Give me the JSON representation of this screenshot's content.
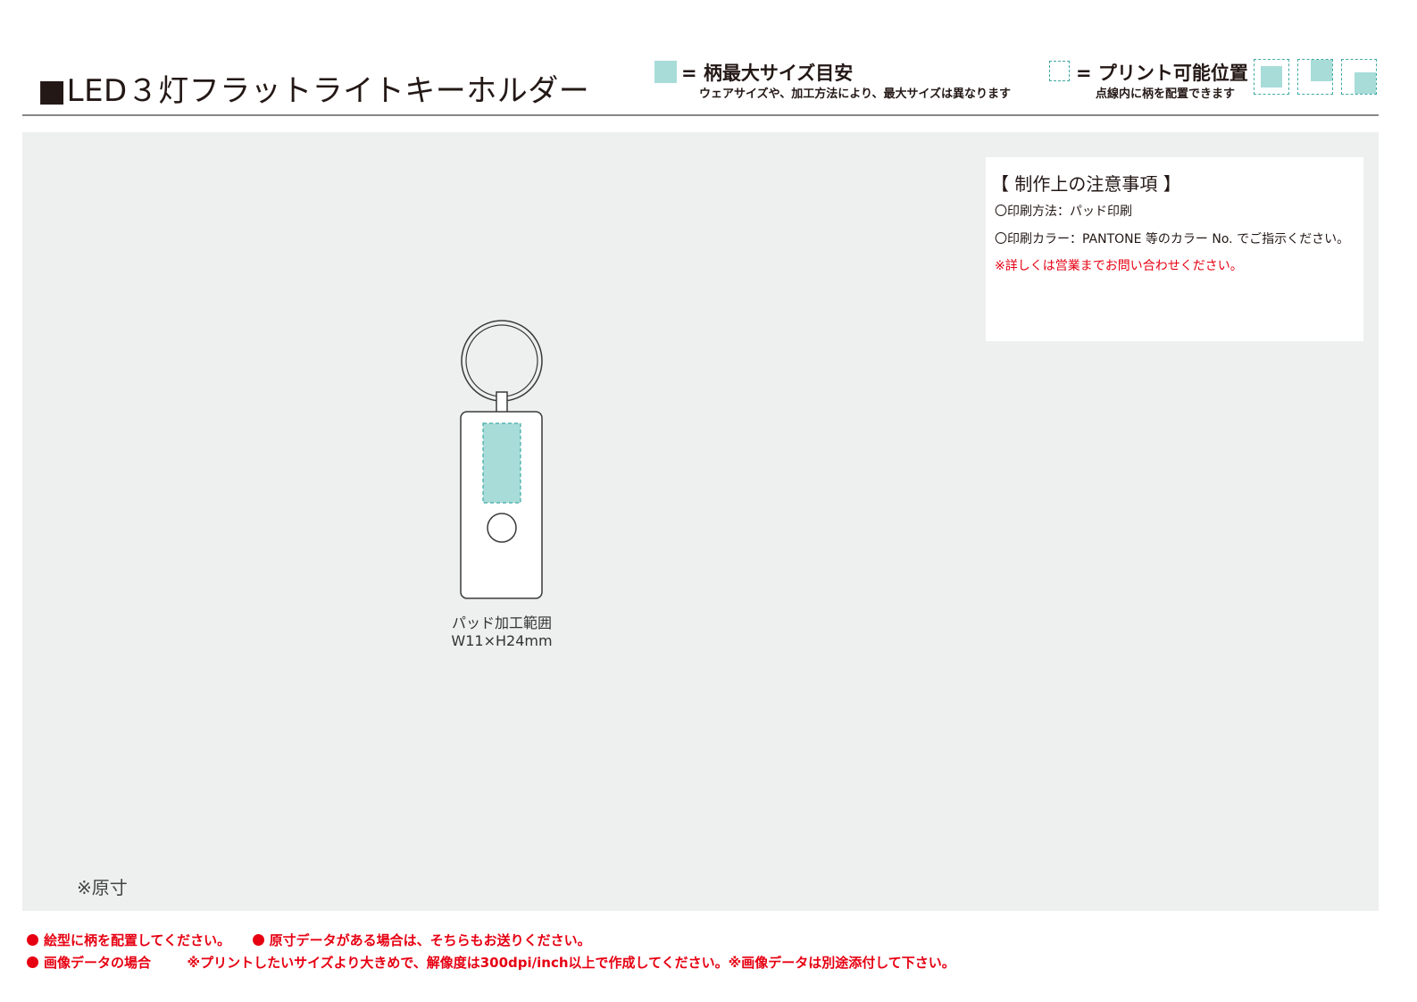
{
  "header": {
    "title": "■LED３灯フラットライトキーホルダー",
    "legend_max_size": {
      "label": "= 柄最大サイズ目安",
      "note": "ウェアサイズや、加工方法により、最大サイズは異なります"
    },
    "legend_print_position": {
      "label": "= プリント可能位置",
      "note": "点線内に柄を配置できます"
    }
  },
  "notes": {
    "title": "【 制作上の注意事項 】",
    "lines": [
      "〇印刷方法：パッド印刷",
      "〇印刷カラー：PANTONE 等のカラー No. でご指示ください。"
    ],
    "warning": "※詳しくは営業までお問い合わせください。"
  },
  "product": {
    "pad_area_label": "パッド加工範囲",
    "pad_area_size": "W11×H24mm"
  },
  "scale_note": "※原寸",
  "footer": {
    "line1_a": "絵型に柄を配置してください。",
    "line1_b": "原寸データがある場合は、そちらもお送りください。",
    "line2_a": "画像データの場合",
    "line2_b": "※プリントしたいサイズより大きめで、解像度は300dpi/inch以上で作成してください。※画像データは別途添付して下さい。"
  },
  "colors": {
    "print_area_fill": "#a8dcd9",
    "print_area_border": "#3fa9a4",
    "accent_red": "#e60012",
    "canvas_bg": "#eeefef"
  }
}
